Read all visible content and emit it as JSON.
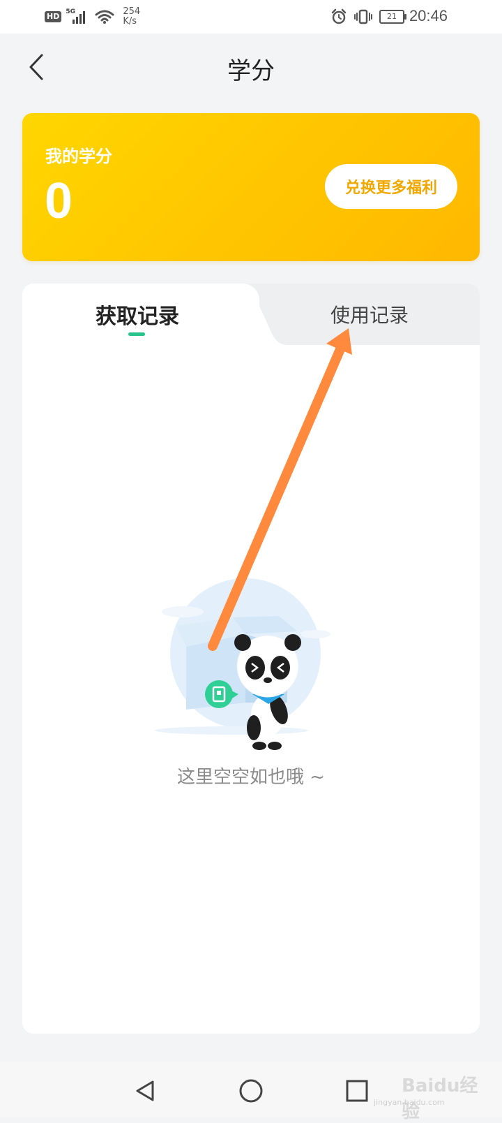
{
  "status_bar": {
    "hd": "HD",
    "network": "5G",
    "speed_value": "254",
    "speed_unit": "K/s",
    "battery": "21",
    "time": "20:46"
  },
  "header": {
    "title": "学分",
    "back_icon": "chevron-left-icon"
  },
  "credits": {
    "label": "我的学分",
    "value": "0",
    "redeem_label": "兑换更多福利",
    "accent": "#ffc800",
    "button_text_color": "#f0a800"
  },
  "tabs": [
    {
      "label": "获取记录",
      "active": true
    },
    {
      "label": "使用记录",
      "active": false
    }
  ],
  "empty_state": {
    "message": "这里空空如也哦 ~",
    "illustration": "panda-with-box-illustration"
  },
  "annotation": {
    "type": "arrow",
    "color": "#ff8a3d",
    "points_to": "使用记录"
  },
  "nav_bar": {
    "back_icon": "triangle-back-icon",
    "home_icon": "circle-home-icon",
    "recent_icon": "square-recent-icon"
  },
  "watermark": {
    "logo": "Baidu经验",
    "url": "jingyan.baidu.com"
  }
}
